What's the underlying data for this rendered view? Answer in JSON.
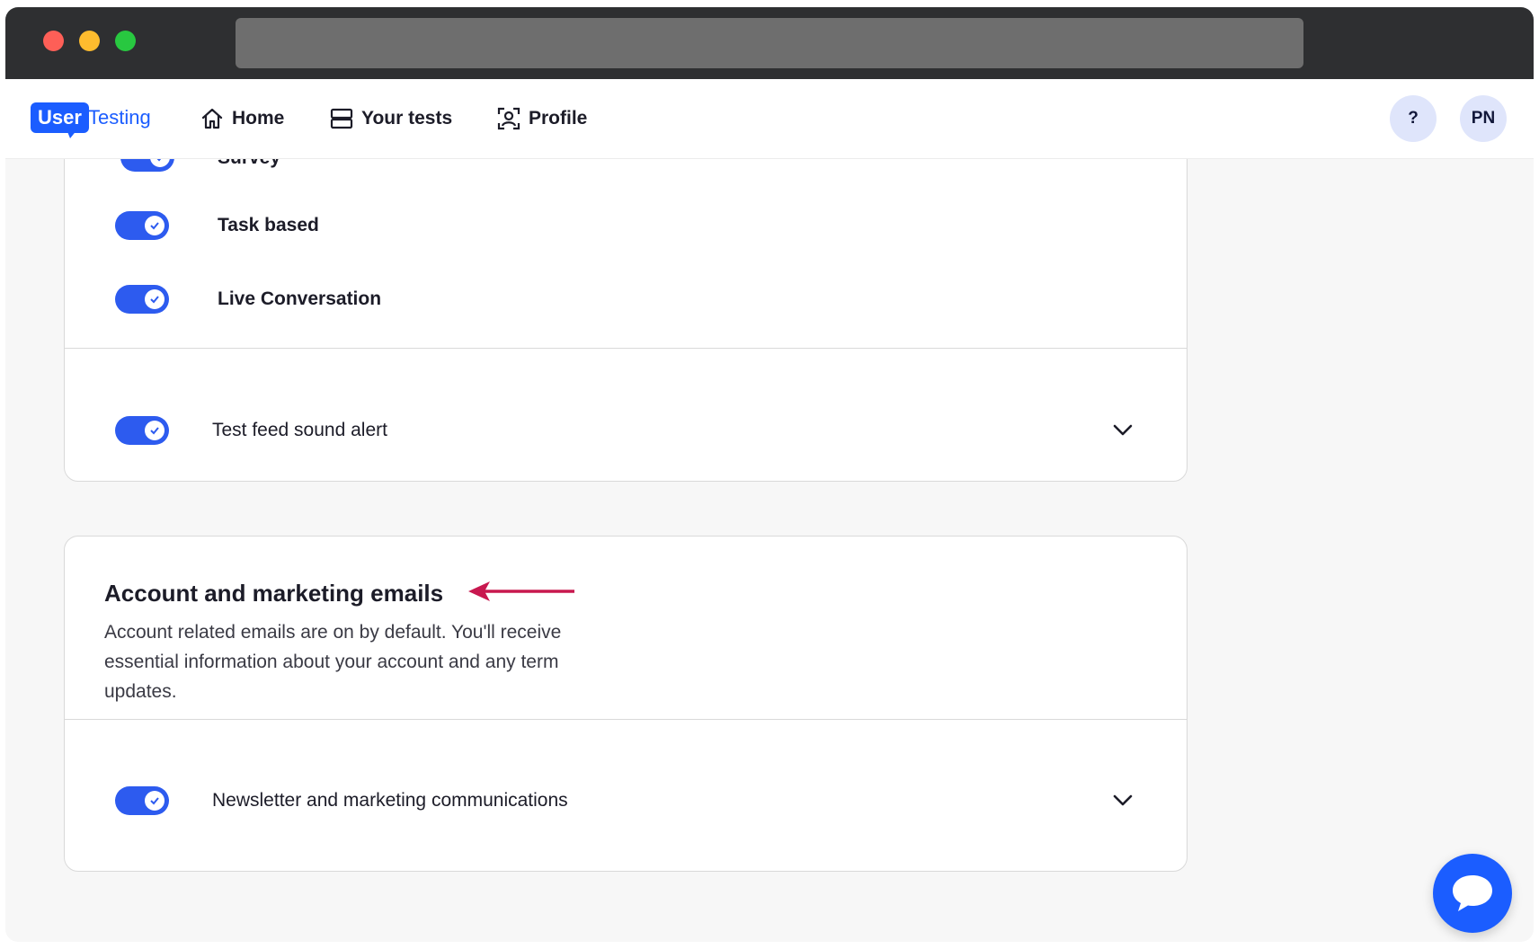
{
  "nav": {
    "logo_user": "User",
    "logo_testing": "Testing",
    "items": [
      {
        "label": "Home",
        "icon": "home-icon"
      },
      {
        "label": "Your tests",
        "icon": "tests-icon"
      },
      {
        "label": "Profile",
        "icon": "profile-icon"
      }
    ],
    "help_label": "?",
    "avatar_initials": "PN"
  },
  "test_types": [
    {
      "label": "Survey",
      "enabled": true
    },
    {
      "label": "Task based",
      "enabled": true
    },
    {
      "label": "Live Conversation",
      "enabled": true
    }
  ],
  "sound_alert": {
    "label": "Test feed sound alert",
    "enabled": true
  },
  "account_emails": {
    "title": "Account and marketing emails",
    "description": "Account related emails are on by default. You'll receive essential information about your account and any term updates.",
    "newsletter": {
      "label": "Newsletter and marketing communications",
      "enabled": true
    }
  },
  "colors": {
    "accent": "#2d5bef",
    "brand": "#1b5dff",
    "annotation_arrow": "#c8184f"
  },
  "icons": {
    "chat": "chat-bubble-icon",
    "expand": "chevron-down-icon",
    "toggle_check": "check-icon"
  }
}
